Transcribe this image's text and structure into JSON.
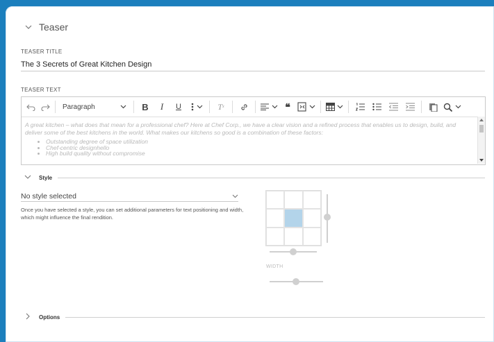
{
  "teaser": {
    "heading": "Teaser",
    "title_label": "TEASER TITLE",
    "title_value": "The 3 Secrets of Great Kitchen Design",
    "text_label": "TEASER TEXT"
  },
  "editor": {
    "paragraph_select": "Paragraph",
    "body_text": "A great kitchen – what does that mean for a professional chef? Here at Chef Corp., we have a clear vision and a refined process that enables us to design, build, and deliver some of the best kitchens in the world. What makes our kitchens so good is a combination of these factors:",
    "bullets": [
      "Outstanding degree of space utilization",
      "Chef-centric designhello",
      "High build quality without compromise"
    ],
    "toolbar_icons": [
      "undo-icon",
      "redo-icon",
      "bold-icon",
      "italic-icon",
      "underline-icon",
      "more-vertical-icon",
      "clear-format-icon",
      "link-icon",
      "align-icon",
      "quote-icon",
      "embed-icon",
      "table-icon",
      "numbered-list-icon",
      "bulleted-list-icon",
      "outdent-icon",
      "indent-icon",
      "paste-icon",
      "find-replace-icon"
    ]
  },
  "style_section": {
    "label": "Style",
    "select_value": "No style selected",
    "help_text": "Once you have selected a style, you can set additional parameters for text positioning and width, which might influence the final rendition.",
    "width_label": "WIDTH",
    "selected_cell": "middle-center"
  },
  "options_section": {
    "label": "Options"
  }
}
